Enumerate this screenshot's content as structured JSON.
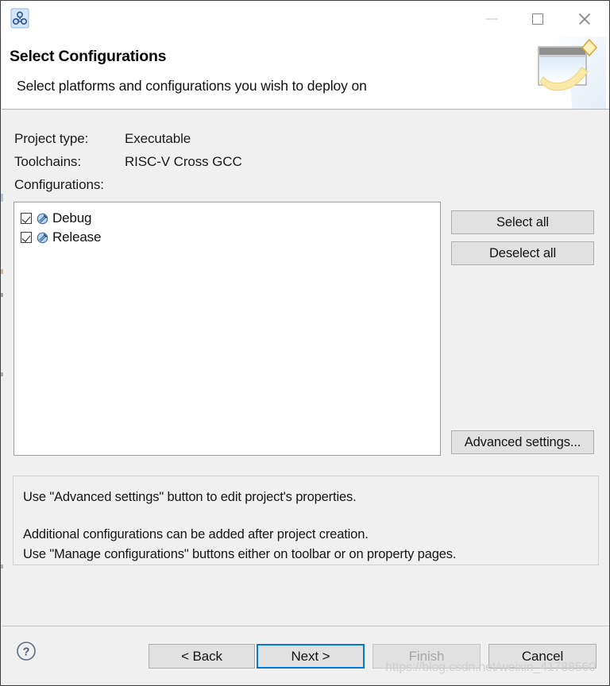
{
  "window": {
    "title": "Select Configurations",
    "app_icon": "project-cluster-icon",
    "controls": {
      "minimize": "minimize-icon",
      "maximize": "maximize-icon",
      "close": "close-icon"
    }
  },
  "header": {
    "title": "Select Configurations",
    "subtitle": "Select platforms and configurations you wish to deploy on",
    "banner_icon": "wizard-window-banner-icon"
  },
  "info": {
    "project_type_label": "Project type:",
    "project_type_value": "Executable",
    "toolchains_label": "Toolchains:",
    "toolchains_value": "RISC-V Cross GCC",
    "configurations_label": "Configurations:"
  },
  "configurations": {
    "items": [
      {
        "label": "Debug",
        "checked": true,
        "icon": "configuration-icon"
      },
      {
        "label": "Release",
        "checked": true,
        "icon": "configuration-icon"
      }
    ]
  },
  "side_buttons": {
    "select_all": "Select all",
    "deselect_all": "Deselect all",
    "advanced_settings": "Advanced settings..."
  },
  "description": {
    "line1": "Use \"Advanced settings\" button to edit project's properties.",
    "line2": "Additional configurations can be added after project creation.",
    "line3": "Use \"Manage configurations\" buttons either on toolbar or on property pages."
  },
  "footer": {
    "help_icon": "help-question-icon",
    "back": "< Back",
    "next": "Next >",
    "finish": "Finish",
    "cancel": "Cancel",
    "finish_enabled": false,
    "next_focused": true
  },
  "watermark": "https://blog.csdn.net/weixin_41788560",
  "colors": {
    "dialog_background": "#f0f0f0",
    "header_background": "#ffffff",
    "button_face": "#e1e1e1",
    "button_border": "#adadad",
    "focus_border": "#0078d7",
    "disabled_text": "#a6a6a6",
    "list_background": "#ffffff",
    "text": "#111111",
    "watermark": "#cfcfcf"
  }
}
